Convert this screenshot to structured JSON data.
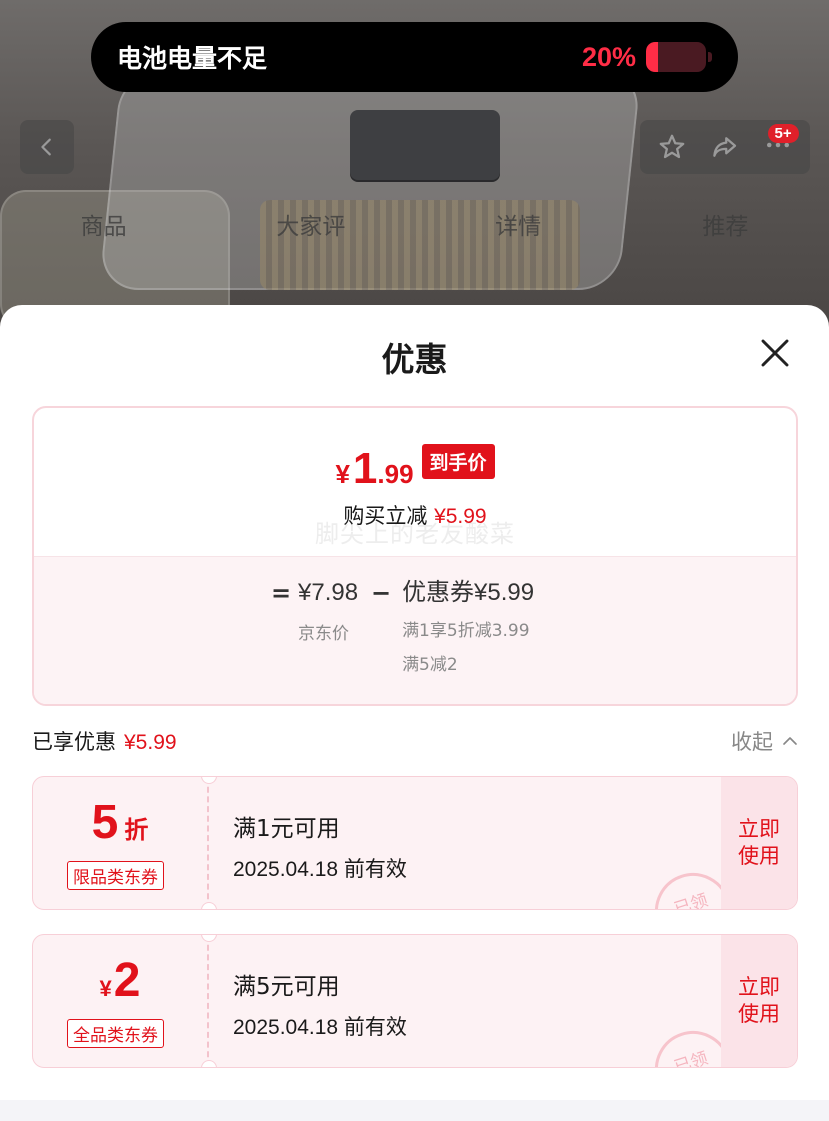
{
  "battery": {
    "message": "电池电量不足",
    "percent_text": "20%",
    "level": 0.2,
    "color": "#ff2d46"
  },
  "product_page": {
    "tabs": [
      "商品",
      "大家评",
      "详情",
      "推荐"
    ],
    "cart_badge": "5+"
  },
  "sheet": {
    "title": "优惠",
    "price": {
      "currency": "¥",
      "integer": "1",
      "decimal": ".99",
      "tag": "到手价",
      "subtitle_prefix": "购买立减 ",
      "subtitle_amount": "¥5.99",
      "watermark": "脚尖上的老友酸菜"
    },
    "calc": {
      "equals": "=",
      "jd_price": "¥7.98",
      "jd_price_label": "京东价",
      "minus": "−",
      "coupon_text": "优惠券¥5.99",
      "coupon_detail_1": "满1享5折减3.99",
      "coupon_detail_2": "满5减2"
    },
    "enjoyed_label": "已享优惠",
    "enjoyed_amount": "¥5.99",
    "collapse_label": "收起",
    "coupons": [
      {
        "amount": "5",
        "unit": "折",
        "type": "限品类东券",
        "condition": "满1元可用",
        "valid": "2025.04.18 前有效",
        "action": "立即\n使用",
        "stamp": "已领"
      },
      {
        "currency": "¥",
        "amount": "2",
        "type": "全品类东券",
        "condition": "满5元可用",
        "valid": "2025.04.18 前有效",
        "action": "立即\n使用",
        "stamp": "已领"
      }
    ]
  },
  "colors": {
    "accent": "#e1121b",
    "card_border": "#f7d5db",
    "coupon_bg": "#fdf2f4"
  }
}
